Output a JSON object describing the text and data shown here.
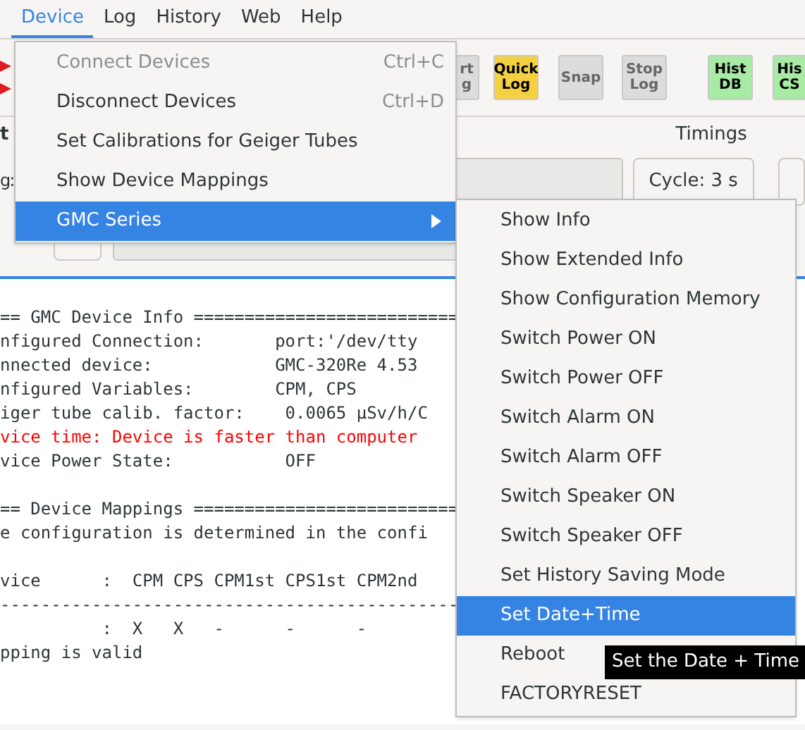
{
  "menubar": [
    {
      "label": "Device",
      "selected": true
    },
    {
      "label": "Log",
      "selected": false
    },
    {
      "label": "History",
      "selected": false
    },
    {
      "label": "Web",
      "selected": false
    },
    {
      "label": "Help",
      "selected": false
    }
  ],
  "toolbar": [
    {
      "label": "rt\ng",
      "color": "#dcdcdc"
    },
    {
      "label": "Quick\nLog",
      "color": "#f5d142"
    },
    {
      "label": "Snap",
      "color": "#dcdcdc"
    },
    {
      "label": "Stop\nLog",
      "color": "#dcdcdc"
    },
    {
      "label": "Hist\nDB",
      "color": "#a8eba4"
    },
    {
      "label": "His\nCS",
      "color": "#a8eba4"
    }
  ],
  "panel": {
    "heading": "t",
    "timings_label": "Timings",
    "row_1_label": "g:",
    "cycle_button": "Cycle: 3 s"
  },
  "log_lines": [
    {
      "kind": "blank"
    },
    {
      "text": "== GMC Device Info ==========================",
      "kind": "normal"
    },
    {
      "text": "nfigured Connection:       port:'/dev/tty",
      "kind": "normal"
    },
    {
      "text": "nnected device:            GMC-320Re 4.53",
      "kind": "normal"
    },
    {
      "text": "nfigured Variables:        CPM, CPS",
      "kind": "normal"
    },
    {
      "text": "iger tube calib. factor:    0.0065 µSv/h/C",
      "kind": "normal"
    },
    {
      "text": "vice time: Device is faster than computer",
      "kind": "error"
    },
    {
      "text": "vice Power State:           OFF",
      "kind": "normal"
    },
    {
      "kind": "blank"
    },
    {
      "text": "== Device Mappings ==========================",
      "kind": "normal"
    },
    {
      "text": "e configuration is determined in the confi",
      "kind": "normal"
    },
    {
      "kind": "blank"
    },
    {
      "text": "vice      :  CPM CPS CPM1st CPS1st CPM2nd",
      "kind": "normal"
    },
    {
      "text": "---------------------------------------------",
      "kind": "normal"
    },
    {
      "text": "          :  X   X   -      -      -",
      "kind": "normal"
    },
    {
      "text": "pping is valid",
      "kind": "normal"
    }
  ],
  "device_menu": [
    {
      "label": "Connect Devices",
      "shortcut": "Ctrl+C",
      "disabled": true,
      "selected": false,
      "submenu": false
    },
    {
      "label": "Disconnect Devices",
      "shortcut": "Ctrl+D",
      "disabled": false,
      "selected": false,
      "submenu": false
    },
    {
      "label": "Set Calibrations for Geiger Tubes",
      "disabled": false,
      "selected": false,
      "submenu": false
    },
    {
      "label": "Show Device Mappings",
      "disabled": false,
      "selected": false,
      "submenu": false
    },
    {
      "label": "GMC Series",
      "disabled": false,
      "selected": true,
      "submenu": true
    }
  ],
  "gmc_submenu": [
    {
      "label": "Show Info",
      "selected": false
    },
    {
      "label": "Show Extended Info",
      "selected": false
    },
    {
      "label": "Show Configuration Memory",
      "selected": false
    },
    {
      "label": "Switch Power ON",
      "selected": false
    },
    {
      "label": "Switch Power OFF",
      "selected": false
    },
    {
      "label": "Switch Alarm ON",
      "selected": false
    },
    {
      "label": "Switch Alarm OFF",
      "selected": false
    },
    {
      "label": "Switch Speaker ON",
      "selected": false
    },
    {
      "label": "Switch Speaker OFF",
      "selected": false
    },
    {
      "label": "Set History Saving Mode",
      "selected": false
    },
    {
      "label": "Set Date+Time",
      "selected": true
    },
    {
      "label": "Reboot",
      "selected": false
    },
    {
      "label": "FACTORYRESET",
      "selected": false
    }
  ],
  "tooltip": "Set the Date + Time"
}
